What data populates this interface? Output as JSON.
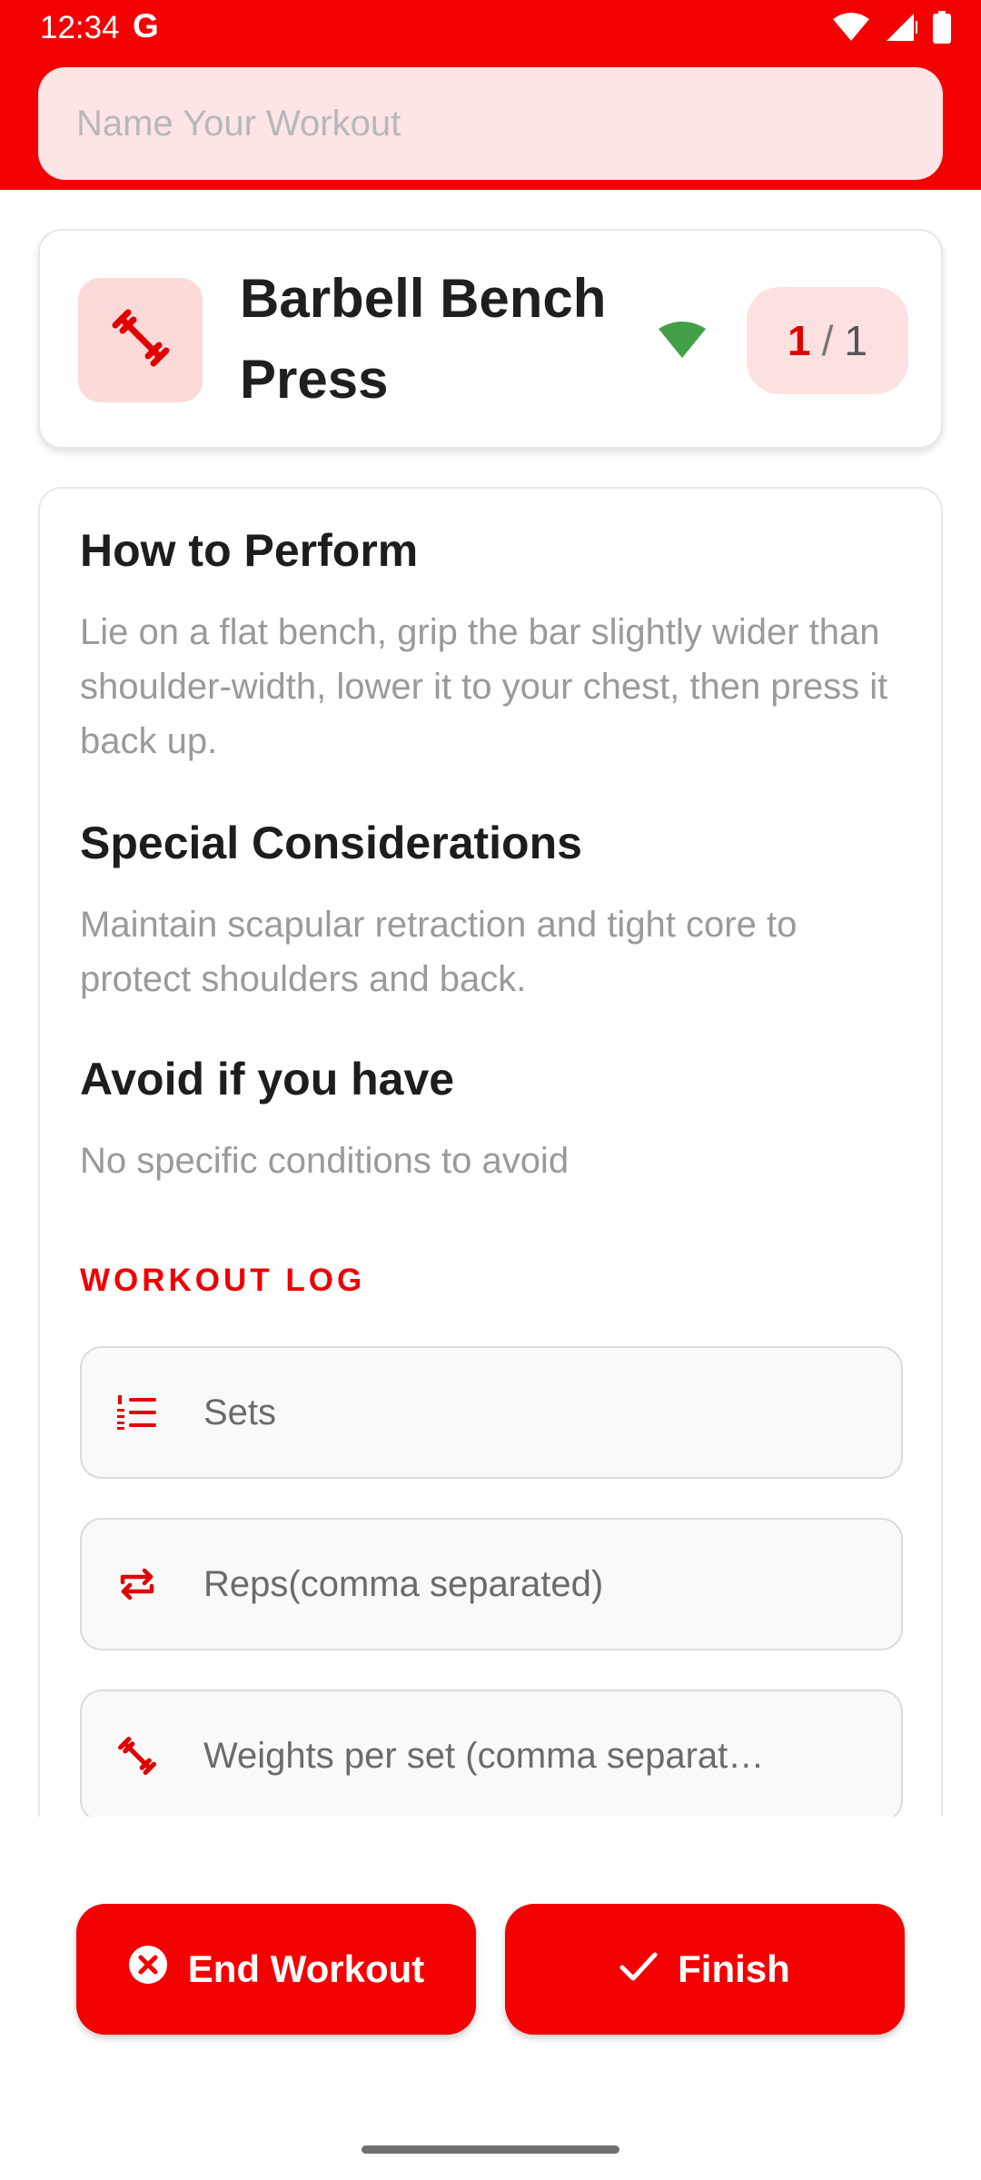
{
  "status_bar": {
    "time": "12:34",
    "g_logo": "G",
    "icons": [
      "wifi-icon",
      "cell-signal-icon",
      "battery-icon"
    ]
  },
  "header": {
    "workout_name_placeholder": "Name Your Workout",
    "background": "#f50000"
  },
  "exercise": {
    "icon": "dumbbell-icon",
    "title": "Barbell Bench Press",
    "signal_icon": "signal-icon",
    "counter_current": "1",
    "counter_separator": "/",
    "counter_total": "1"
  },
  "details": {
    "how_title": "How to Perform",
    "how_body": "Lie on a flat bench, grip the bar slightly wider than shoulder-width, lower it to your chest, then press it back up.",
    "special_title": "Special Considerations",
    "special_body": "Maintain scapular retraction and tight core to protect shoulders and back.",
    "avoid_title": "Avoid if you have",
    "avoid_body": "No specific conditions to avoid"
  },
  "log": {
    "label": "WORKOUT LOG",
    "fields": [
      {
        "icon": "list-numbered-icon",
        "placeholder": "Sets"
      },
      {
        "icon": "repeat-icon",
        "placeholder": "Reps(comma separated)"
      },
      {
        "icon": "dumbbell-icon",
        "placeholder": "Weights per set (comma separat…"
      }
    ]
  },
  "actions": {
    "end_label": "End Workout",
    "end_icon": "cancel-circle-icon",
    "finish_label": "Finish",
    "finish_icon": "check-icon"
  },
  "colors": {
    "accent": "#f50000",
    "accent_light": "#fde1e1",
    "signal_green": "#43a047"
  }
}
